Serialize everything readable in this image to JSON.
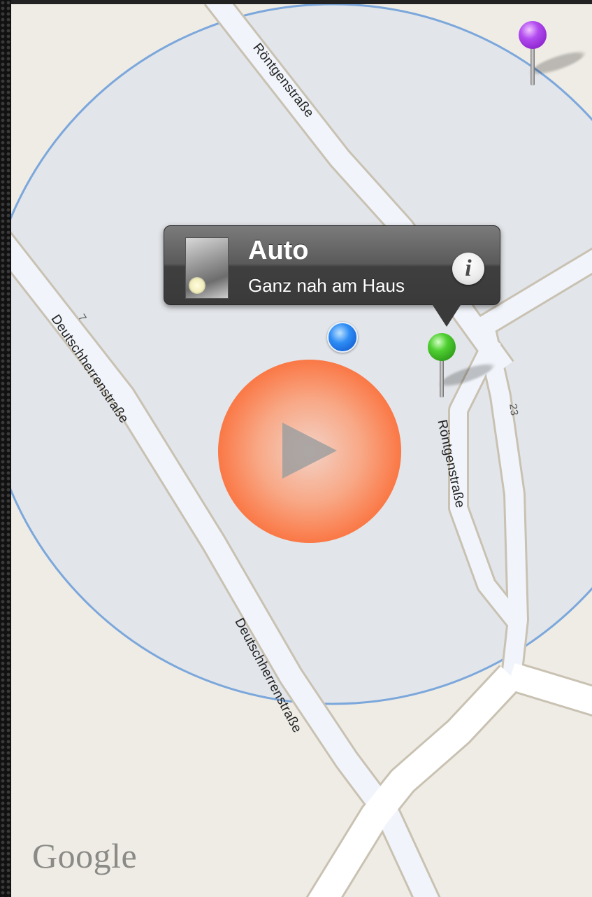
{
  "map": {
    "streets": [
      {
        "name": "Röntgenstraße"
      },
      {
        "name": "Deutschherrenstraße"
      },
      {
        "name": "Röntgenstraße"
      },
      {
        "name": "Deutschherrenstraße"
      }
    ],
    "house_numbers": [
      "7",
      "23"
    ],
    "attribution": "Google",
    "colors": {
      "land": "#efece5",
      "accuracy_circle_fill": "#e2e5e9",
      "accuracy_circle_stroke": "#7ba7dc",
      "road": "#ffffff",
      "road_in_circle": "#f1f5fb",
      "road_edge": "#c9c2b3"
    }
  },
  "callout": {
    "title": "Auto",
    "subtitle": "Ganz nah am Haus",
    "info_glyph": "i"
  },
  "pins": [
    {
      "color": "purple",
      "head": "#a032e0"
    },
    {
      "color": "green",
      "head": "#3fbf26"
    }
  ],
  "user_location": {
    "color": "#2f8df5"
  },
  "play_button": {
    "icon": "play-icon",
    "color": "#ff5a1f"
  }
}
